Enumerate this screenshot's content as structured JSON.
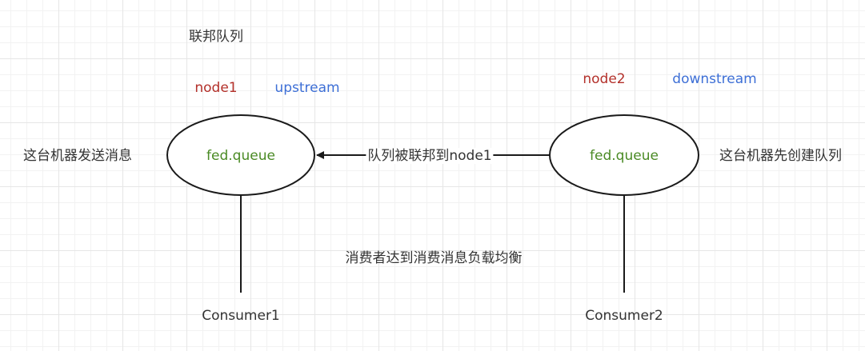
{
  "title": "联邦队列",
  "colors": {
    "node_label": "#b3302a",
    "role_label": "#3d6fd6",
    "queue_label": "#4a8a24",
    "text": "#333333",
    "stroke": "#1a1a1a"
  },
  "left": {
    "node_label": "node1",
    "role_label": "upstream",
    "queue_label": "fed.queue",
    "side_note": "这台机器发送消息",
    "consumer_label": "Consumer1"
  },
  "right": {
    "node_label": "node2",
    "role_label": "downstream",
    "queue_label": "fed.queue",
    "side_note": "这台机器先创建队列",
    "consumer_label": "Consumer2"
  },
  "edge_label": "队列被联邦到node1",
  "middle_note": "消费者达到消费消息负载均衡"
}
